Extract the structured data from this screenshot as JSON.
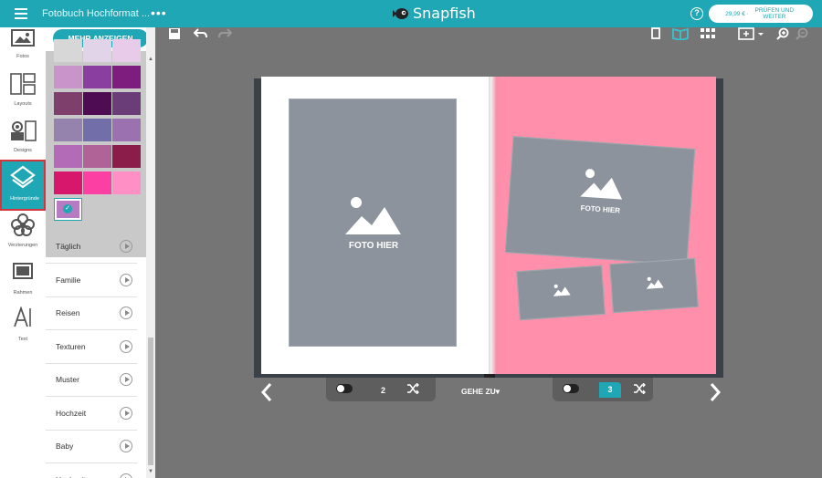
{
  "topbar": {
    "doc_title": "Fotobuch Hochformat ...",
    "more_dots": "•••",
    "brand": "Snapfish",
    "help": "?",
    "price": "29,99 € ·",
    "check_label": "PRÜFEN UND WEITER"
  },
  "rail": {
    "items": [
      {
        "label": "Fotos",
        "icon": "photos-icon"
      },
      {
        "label": "Layouts",
        "icon": "layouts-icon"
      },
      {
        "label": "Designs",
        "icon": "designs-icon"
      },
      {
        "label": "Hintergründe",
        "icon": "backgrounds-icon",
        "active": true
      },
      {
        "label": "Verzierungen",
        "icon": "embellishments-icon"
      },
      {
        "label": "Rahmen",
        "icon": "frames-icon"
      },
      {
        "label": "Text",
        "icon": "text-icon"
      }
    ]
  },
  "panel": {
    "more_button": "MEHR ANZEIGEN",
    "swatch_colors": [
      [
        "#d7d7d7",
        "#e2d4e8",
        "#e7cbe9"
      ],
      [
        "#c994c9",
        "#8a3fa0",
        "#7f1d7f"
      ],
      [
        "#7e3f6c",
        "#4e0d52",
        "#6a3d78"
      ],
      [
        "#9683ad",
        "#716eaa",
        "#9b71b0"
      ],
      [
        "#b46bb7",
        "#b06396",
        "#8b1d4a"
      ],
      [
        "#d7176c",
        "#fb3fa3",
        "#ff8fc4"
      ]
    ],
    "selected_swatch_color": "#b67bc1",
    "categories": [
      "Täglich",
      "Familie",
      "Reisen",
      "Texturen",
      "Muster",
      "Hochzeit",
      "Baby",
      "Hochzeit"
    ]
  },
  "canvas": {
    "left_photo_label": "FOTO HIER",
    "right_photo_label": "FOTO HIER",
    "accent_page_color": "#ff8fab",
    "placeholder_color": "#8c939c"
  },
  "pager": {
    "left_page": "2",
    "right_page": "3",
    "goto_label": "GEHE ZU"
  },
  "colors": {
    "accent": "#1fa7b5",
    "active_outline": "#d4343b"
  }
}
